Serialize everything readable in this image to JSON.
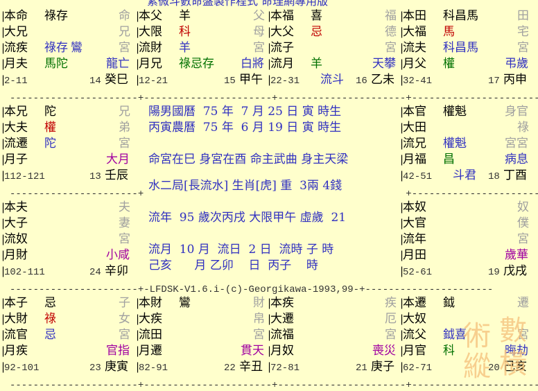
{
  "header": "紫微斗數命盤製作程式 命理網專用版",
  "footer": "LFDSK-V1.6.i-(c)-Georgikawa-1993,99",
  "watermark": [
    "術",
    "數",
    "縱",
    "橫"
  ],
  "colors": {
    "default": "#000000",
    "blue": "#3030c0",
    "green": "#007000",
    "red": "#c00000",
    "magenta": "#a000a0",
    "gray": "#a0a0a0",
    "bg": "#ffffcc"
  },
  "palaces": [
    {
      "id": "si",
      "lines": [
        {
          "l": "本命",
          "s": [
            {
              "t": "祿存",
              "c": "default"
            }
          ],
          "r": "命",
          "rc": "gray"
        },
        {
          "l": "大兄",
          "s": [],
          "r": "兄",
          "rc": "gray"
        },
        {
          "l": "流疾",
          "s": [
            {
              "t": "祿存",
              "c": "blue"
            },
            {
              "t": "鸞",
              "c": "blue"
            }
          ],
          "r": "宮",
          "rc": "gray"
        },
        {
          "l": "月夫",
          "s": [
            {
              "t": "馬陀",
              "c": "green"
            }
          ],
          "r": "龍亡",
          "rc": "blue"
        }
      ],
      "bottom": {
        "age": "2-11",
        "num": "14",
        "gz": "癸巳"
      }
    },
    {
      "id": "wu",
      "lines": [
        {
          "l": "本父",
          "s": [
            {
              "t": "羊",
              "c": "default"
            }
          ],
          "r": "父",
          "rc": "gray"
        },
        {
          "l": "大限",
          "s": [
            {
              "t": "科",
              "c": "red"
            }
          ],
          "r": "母",
          "rc": "gray"
        },
        {
          "l": "流財",
          "s": [
            {
              "t": "羊",
              "c": "blue"
            }
          ],
          "r": "宮",
          "rc": "gray"
        },
        {
          "l": "月兄",
          "s": [
            {
              "t": "祿忌存",
              "c": "green"
            }
          ],
          "r": "白將",
          "rc": "blue"
        }
      ],
      "bottom": {
        "age": "12-21",
        "num": "15",
        "gz": "甲午"
      }
    },
    {
      "id": "wei",
      "lines": [
        {
          "l": "本福",
          "s": [
            {
              "t": "喜",
              "c": "default"
            }
          ],
          "r": "福",
          "rc": "gray"
        },
        {
          "l": "大父",
          "s": [
            {
              "t": "忌",
              "c": "red"
            }
          ],
          "r": "德",
          "rc": "gray"
        },
        {
          "l": "流子",
          "s": [],
          "r": "宮",
          "rc": "gray"
        },
        {
          "l": "流月",
          "s": [
            {
              "t": "羊",
              "c": "green"
            }
          ],
          "r": "天攀",
          "rc": "blue"
        }
      ],
      "bottom": {
        "age": "22-31",
        "mid": "流斗",
        "num": "16",
        "gz": "乙未"
      }
    },
    {
      "id": "shen",
      "lines": [
        {
          "l": "本田",
          "s": [
            {
              "t": "科昌馬",
              "c": "default"
            }
          ],
          "r": "田",
          "rc": "gray"
        },
        {
          "l": "大福",
          "s": [
            {
              "t": "馬",
              "c": "red"
            }
          ],
          "r": "宅",
          "rc": "gray"
        },
        {
          "l": "流夫",
          "s": [
            {
              "t": "科昌馬",
              "c": "blue"
            }
          ],
          "r": "宮",
          "rc": "gray"
        },
        {
          "l": "月父",
          "s": [
            {
              "t": "權",
              "c": "green"
            }
          ],
          "r": "弔歲",
          "rc": "blue"
        }
      ],
      "bottom": {
        "age": "32-41",
        "num": "17",
        "gz": "丙申"
      }
    },
    {
      "id": "chen",
      "lines": [
        {
          "l": "本兄",
          "s": [
            {
              "t": "陀",
              "c": "default"
            }
          ],
          "r": "兄",
          "rc": "gray"
        },
        {
          "l": "大夫",
          "s": [
            {
              "t": "權",
              "c": "red"
            }
          ],
          "r": "弟",
          "rc": "gray"
        },
        {
          "l": "流遷",
          "s": [
            {
              "t": "陀",
              "c": "blue"
            }
          ],
          "r": "宮",
          "rc": "gray"
        },
        {
          "l": "月子",
          "s": [],
          "r": "大月",
          "rc": "magenta"
        }
      ],
      "bottom": {
        "age": "112-121",
        "num": "13",
        "gz": "壬辰"
      }
    },
    {
      "id": "you",
      "lines": [
        {
          "l": "本官",
          "s": [
            {
              "t": "權魁",
              "c": "default"
            }
          ],
          "r": "身官",
          "rc": "gray"
        },
        {
          "l": "大田",
          "s": [],
          "r": "祿",
          "rc": "gray"
        },
        {
          "l": "流兄",
          "s": [
            {
              "t": "權魁",
              "c": "blue"
            }
          ],
          "r": "宮宮",
          "rc": "gray"
        },
        {
          "l": "月福",
          "s": [
            {
              "t": "昌",
              "c": "green"
            }
          ],
          "r": "病息",
          "rc": "blue"
        }
      ],
      "bottom": {
        "age": "42-51",
        "mid": "斗君",
        "num": "18",
        "gz": "丁酉"
      }
    },
    {
      "id": "mao",
      "lines": [
        {
          "l": "本夫",
          "s": [],
          "r": "夫",
          "rc": "gray"
        },
        {
          "l": "大子",
          "s": [],
          "r": "妻",
          "rc": "gray"
        },
        {
          "l": "流奴",
          "s": [],
          "r": "宮",
          "rc": "gray"
        },
        {
          "l": "月財",
          "s": [],
          "r": "小咸",
          "rc": "magenta"
        }
      ],
      "bottom": {
        "age": "102-111",
        "num": "24",
        "gz": "辛卯"
      }
    },
    {
      "id": "xu",
      "lines": [
        {
          "l": "本奴",
          "s": [],
          "r": "奴",
          "rc": "gray"
        },
        {
          "l": "大官",
          "s": [],
          "r": "僕",
          "rc": "gray"
        },
        {
          "l": "流年",
          "s": [],
          "r": "宮",
          "rc": "gray"
        },
        {
          "l": "月田",
          "s": [],
          "r": "歲華",
          "rc": "magenta"
        }
      ],
      "bottom": {
        "age": "52-61",
        "num": "19",
        "gz": "戊戌"
      }
    },
    {
      "id": "yin",
      "lines": [
        {
          "l": "本子",
          "s": [
            {
              "t": "忌",
              "c": "default"
            }
          ],
          "r": "子",
          "rc": "gray"
        },
        {
          "l": "大財",
          "s": [
            {
              "t": "祿",
              "c": "red"
            }
          ],
          "r": "女",
          "rc": "gray"
        },
        {
          "l": "流官",
          "s": [
            {
              "t": "忌",
              "c": "blue"
            }
          ],
          "r": "宮",
          "rc": "gray"
        },
        {
          "l": "月疾",
          "s": [],
          "r": "官指",
          "rc": "magenta"
        }
      ],
      "bottom": {
        "age": "92-101",
        "num": "23",
        "gz": "庚寅"
      }
    },
    {
      "id": "chou",
      "lines": [
        {
          "l": "本財",
          "s": [
            {
              "t": "鸞",
              "c": "default"
            }
          ],
          "r": "財",
          "rc": "gray"
        },
        {
          "l": "大疾",
          "s": [],
          "r": "帛",
          "rc": "gray"
        },
        {
          "l": "流田",
          "s": [],
          "r": "宮",
          "rc": "gray"
        },
        {
          "l": "月遷",
          "s": [],
          "r": "貫天",
          "rc": "magenta"
        }
      ],
      "bottom": {
        "age": "82-91",
        "num": "22",
        "gz": "辛丑"
      }
    },
    {
      "id": "zi",
      "lines": [
        {
          "l": "本疾",
          "s": [],
          "r": "疾",
          "rc": "gray"
        },
        {
          "l": "大遷",
          "s": [],
          "r": "厄",
          "rc": "gray"
        },
        {
          "l": "流福",
          "s": [],
          "r": "宮",
          "rc": "gray"
        },
        {
          "l": "月奴",
          "s": [],
          "r": "喪災",
          "rc": "magenta"
        }
      ],
      "bottom": {
        "age": "72-81",
        "num": "21",
        "gz": "庚子"
      }
    },
    {
      "id": "hai",
      "lines": [
        {
          "l": "本遷",
          "s": [
            {
              "t": "鉞",
              "c": "default"
            }
          ],
          "r": "遷",
          "rc": "gray"
        },
        {
          "l": "大奴",
          "s": [],
          "r": "",
          "rc": "gray"
        },
        {
          "l": "流父",
          "s": [
            {
              "t": "鉞喜",
              "c": "blue"
            }
          ],
          "r": "宮",
          "rc": "gray"
        },
        {
          "l": "月官",
          "s": [
            {
              "t": "科",
              "c": "green"
            }
          ],
          "r": "晦劫",
          "rc": "blue"
        }
      ],
      "bottom": {
        "age": "62-71",
        "num": "20",
        "gz": "己亥"
      }
    }
  ],
  "center": [
    {
      "t": "陽男國曆  75 年  7 月 25 日 寅 時生",
      "c": "blue"
    },
    {
      "t": "丙寅農曆  75 年  6 月 19 日 寅 時生",
      "c": "blue"
    },
    {
      "t": "",
      "c": "blue"
    },
    {
      "t": "命宮在巳 身宮在酉 命主武曲 身主天梁",
      "c": "blue"
    },
    {
      "t": "",
      "c": "blue"
    },
    {
      "t": "水二局[長流水] 生肖[虎] 重  3兩 4錢",
      "c": "blue"
    },
    {
      "t": "",
      "c": "blue"
    },
    {
      "t": "流年  95 歲次丙戌 大限甲午 虛歲  21",
      "c": "blue"
    },
    {
      "t": "",
      "c": "blue"
    },
    {
      "t": "流月  10 月  流日  2 日  流時 子 時",
      "c": "blue"
    },
    {
      "t": "己亥      月 乙卯    日  丙子    時",
      "c": "blue"
    }
  ]
}
